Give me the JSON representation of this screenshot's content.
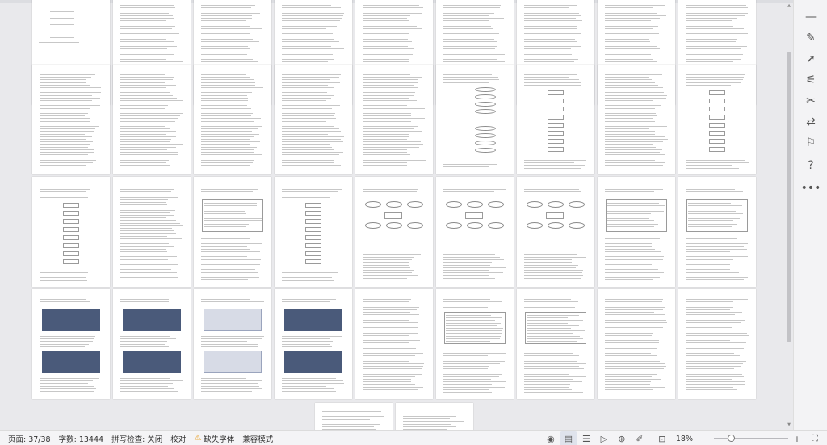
{
  "status": {
    "page_label": "页面: 37/38",
    "words_label": "字数: 13444",
    "spellcheck_label": "拼写检查: 关闭",
    "proof_label": "校对",
    "missing_font_label": "缺失字体",
    "compat_label": "兼容模式",
    "zoom": "18%",
    "zoom_minus": "−",
    "zoom_plus": "+",
    "zoom_level_fraction": 0.2
  },
  "icons": {
    "view": [
      "eye-icon",
      "page-view-icon",
      "list-icon",
      "play-icon",
      "globe-icon",
      "pen-icon",
      "fit-icon",
      "fullscreen-icon"
    ],
    "right_toolbar": [
      "minimize-icon",
      "edit-icon",
      "select-arrow-icon",
      "adjust-icon",
      "tools-icon",
      "translate-icon",
      "shirt-icon",
      "help-icon",
      "more-icon"
    ]
  },
  "colors": {
    "warning": "#e8a12a",
    "background": "#e9e9ec",
    "page": "#ffffff"
  }
}
